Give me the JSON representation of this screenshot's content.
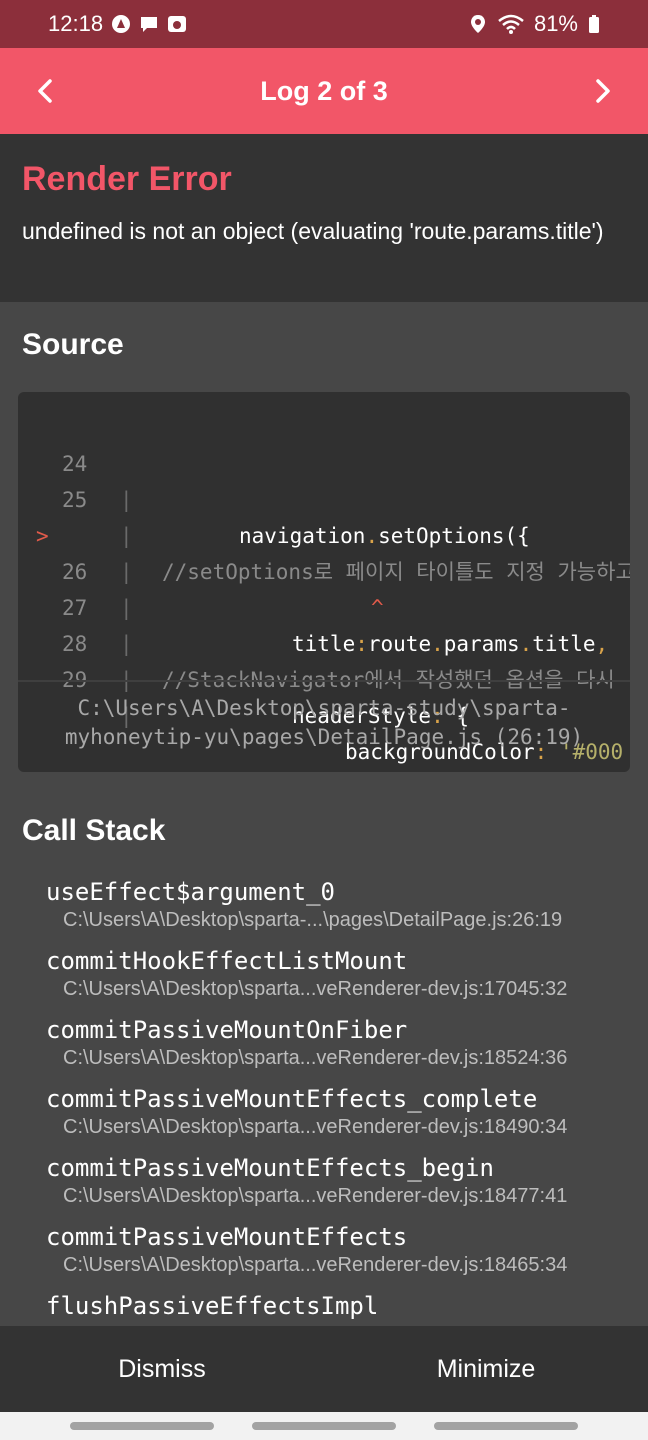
{
  "status_bar": {
    "time": "12:18",
    "battery": "81%",
    "icons_left": [
      "navigation-app-icon",
      "chat-icon",
      "camera-app-icon"
    ],
    "icons_right": [
      "location-icon",
      "wifi-icon",
      "battery-icon"
    ]
  },
  "header": {
    "title": "Log 2 of 3",
    "prev_icon": "chevron-left-icon",
    "next_icon": "chevron-right-icon",
    "color": "#f25668"
  },
  "error": {
    "title": "Render Error",
    "message": "undefined is not an object (evaluating 'route.params.title')"
  },
  "source": {
    "title": "Source",
    "lines": [
      {
        "num": "24",
        "text": "navigation.setOptions({"
      },
      {
        "num": "25",
        "text": "//setOptions로 페이지 타이틀도 지정 가능하고"
      },
      {
        "num": "26",
        "marker": ">",
        "text": "title:route.params.title,"
      },
      {
        "num": "",
        "text": "^"
      },
      {
        "num": "27",
        "text": "//StackNavigator에서 작성했던 옵션을 다시"
      },
      {
        "num": "28",
        "text": "headerStyle: {"
      },
      {
        "num": "29",
        "text": "backgroundColor: '#000"
      }
    ],
    "file": "C:\\Users\\A\\Desktop\\sparta-study\\sparta-myhoneytip-yu\\pages\\DetailPage.js (26:19)",
    "file_line1": "C:\\Users\\A\\Desktop\\sparta-study\\sparta-",
    "file_line2": "myhoneytip-yu\\pages\\DetailPage.js (26:19)"
  },
  "call_stack": {
    "title": "Call Stack",
    "items": [
      {
        "fn": "useEffect$argument_0",
        "loc": "C:\\Users\\A\\Desktop\\sparta-...\\pages\\DetailPage.js:26:19"
      },
      {
        "fn": "commitHookEffectListMount",
        "loc": "C:\\Users\\A\\Desktop\\sparta...veRenderer-dev.js:17045:32"
      },
      {
        "fn": "commitPassiveMountOnFiber",
        "loc": "C:\\Users\\A\\Desktop\\sparta...veRenderer-dev.js:18524:36"
      },
      {
        "fn": "commitPassiveMountEffects_complete",
        "loc": "C:\\Users\\A\\Desktop\\sparta...veRenderer-dev.js:18490:34"
      },
      {
        "fn": "commitPassiveMountEffects_begin",
        "loc": "C:\\Users\\A\\Desktop\\sparta...veRenderer-dev.js:18477:41"
      },
      {
        "fn": "commitPassiveMountEffects",
        "loc": "C:\\Users\\A\\Desktop\\sparta...veRenderer-dev.js:18465:34"
      },
      {
        "fn": "flushPassiveEffectsImpl",
        "loc": ""
      }
    ]
  },
  "footer": {
    "dismiss_label": "Dismiss",
    "minimize_label": "Minimize"
  }
}
